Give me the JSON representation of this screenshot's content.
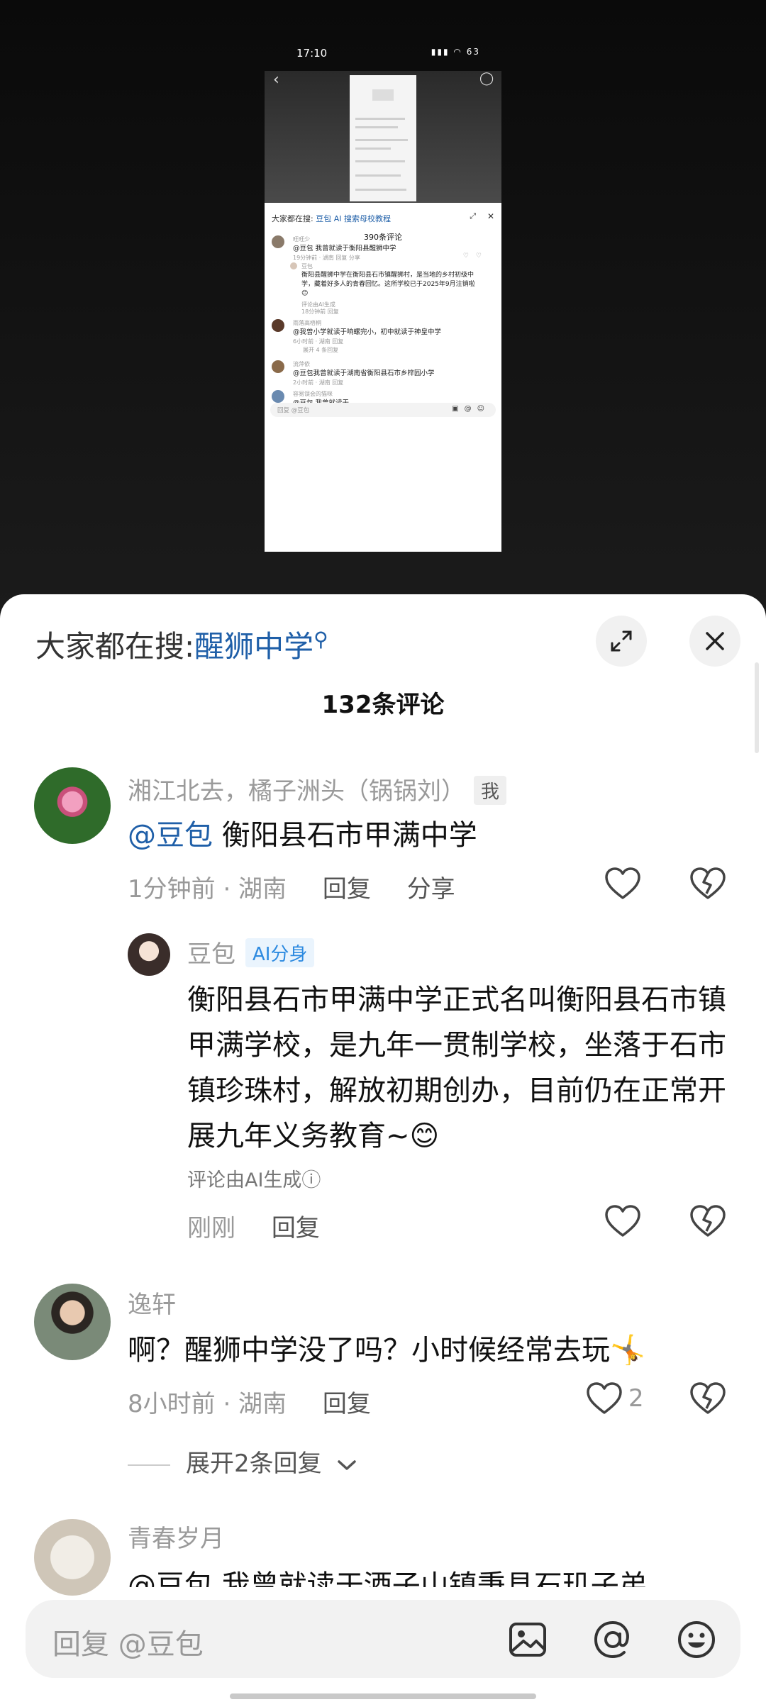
{
  "bg_status": {
    "time": "17:10",
    "battery": "63"
  },
  "thumbnail": {
    "search_prefix": "大家都在搜:",
    "search_term": "豆包 AI 搜索母校教程",
    "comment_count": "390条评论",
    "comments": [
      {
        "name": "旺旺少",
        "text": "@豆包 我曾就读于衡阳县醒狮中学",
        "meta": "19分钟前 · 湖南   回复   分享"
      },
      {
        "name": "豆包",
        "text": "衡阳县醒狮中学在衡阳县石市镇醒狮村，是当地的乡村初级中学，藏着好多人的青春回忆。这所学校已于2025年9月注销啦😊",
        "note": "评论由AI生成",
        "meta": "18分钟前   回复"
      },
      {
        "name": "雨落高梧桐",
        "text": "@我曾小学就读于响螺完小，初中就读于神皇中学",
        "meta": "6小时前 · 湖南   回复",
        "expand": "展开 4 条回复"
      },
      {
        "name": "流萍依",
        "text": "@豆包我曾就读于湖南省衡阳县石市乡梓园小学",
        "meta": "2小时前 · 湖南   回复"
      },
      {
        "name": "容易误会的猫咪",
        "text": "@豆包 我曾就读于..."
      }
    ],
    "input_placeholder": "回复 @豆包"
  },
  "sheet": {
    "search_prefix": "大家都在搜:",
    "search_term": "醒狮中学",
    "comment_count": "132条评论"
  },
  "comments": [
    {
      "name": "湘江北去，橘子洲头（锅锅刘）",
      "badge": "我",
      "mention": "@豆包",
      "text": "衡阳县石市甲满中学",
      "time": "1分钟前 · 湖南",
      "reply": "回复",
      "share": "分享",
      "reply_item": {
        "name": "豆包",
        "badge": "AI分身",
        "text": "衡阳县石市甲满中学正式名叫衡阳县石市镇甲满学校，是九年一贯制学校，坐落于石市镇珍珠村，解放初期创办，目前仍在正常开展九年义务教育~😊",
        "note": "评论由AI生成ⓘ",
        "time": "刚刚",
        "reply": "回复"
      }
    },
    {
      "name": "逸轩",
      "text": "啊？醒狮中学没了吗？小时候经常去玩🤸",
      "time": "8小时前 · 湖南",
      "reply": "回复",
      "likes": "2",
      "expand": "展开2条回复"
    },
    {
      "name": "青春岁月",
      "text": "@豆包 我曾就读于酒子山镇秉县石玑子弟"
    }
  ],
  "input": {
    "placeholder": "回复 @豆包"
  }
}
